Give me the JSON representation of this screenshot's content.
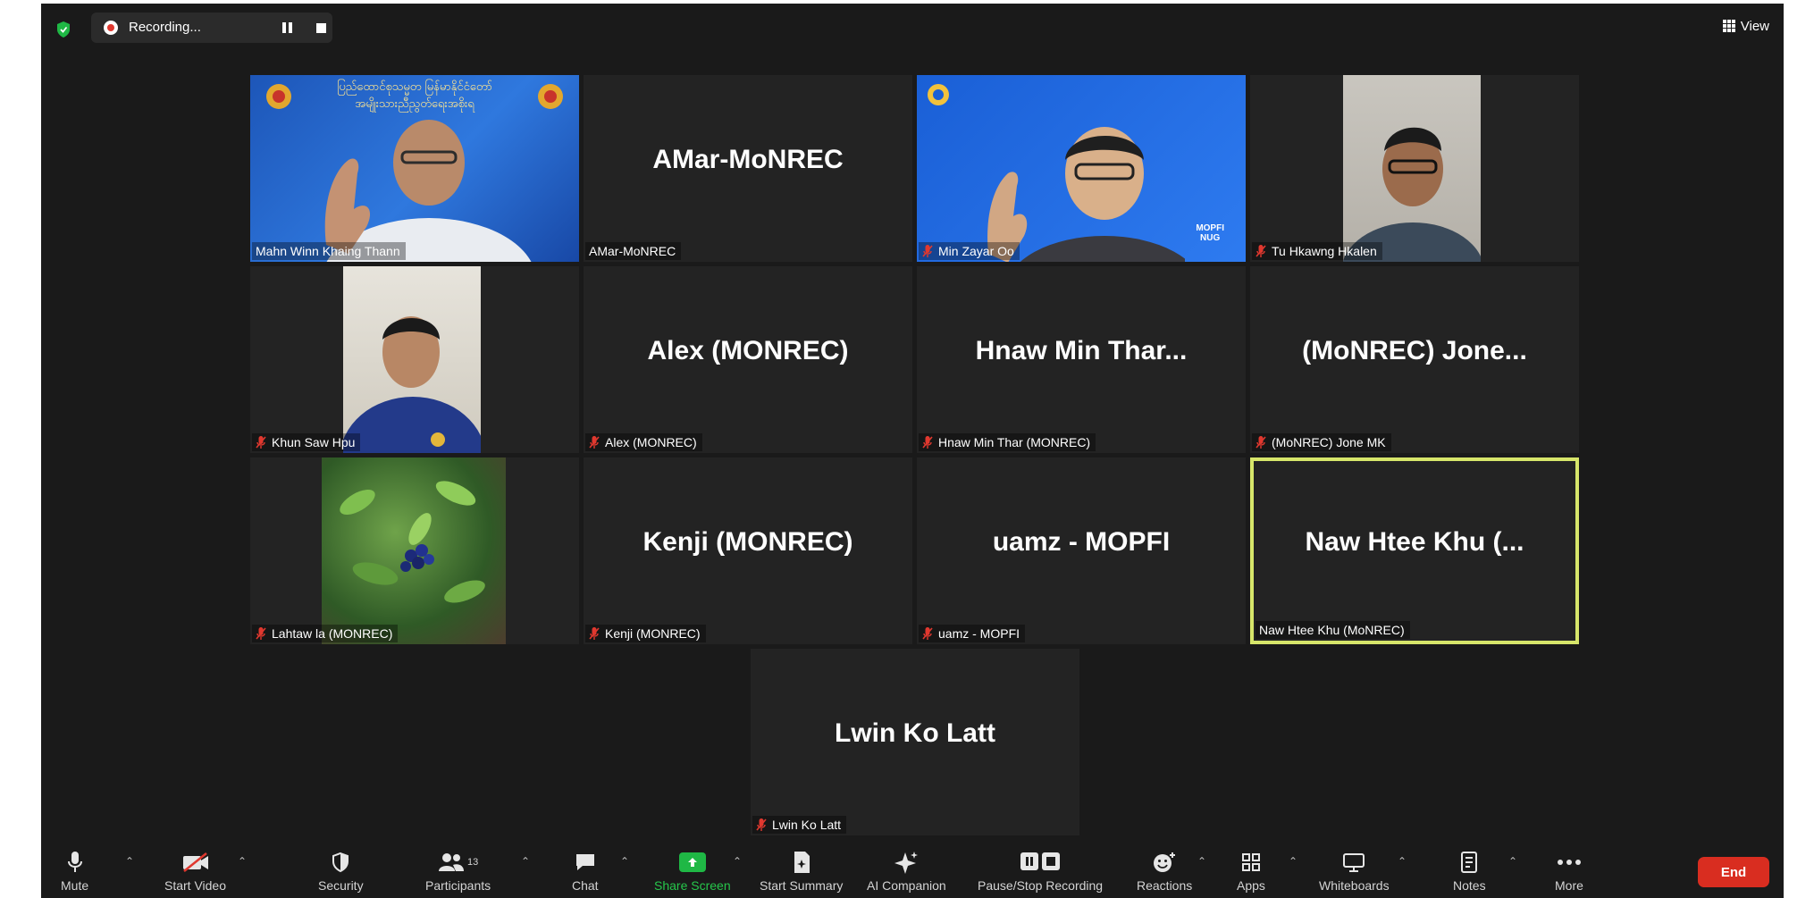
{
  "topbar": {
    "recording_label": "Recording...",
    "view_label": "View"
  },
  "tiles": [
    {
      "id": "mahn",
      "display_name": "",
      "nameplate": "Mahn Winn Khaing Thann",
      "muted": false
    },
    {
      "id": "amar",
      "display_name": "AMar-MoNREC",
      "nameplate": "AMar-MoNREC",
      "muted": false
    },
    {
      "id": "minzayar",
      "display_name": "",
      "nameplate": "Min Zayar Oo",
      "muted": true
    },
    {
      "id": "tuhkawng",
      "display_name": "",
      "nameplate": "Tu Hkawng Hkalen",
      "muted": true
    },
    {
      "id": "khunsaw",
      "display_name": "",
      "nameplate": "Khun Saw Hpu",
      "muted": true
    },
    {
      "id": "alex",
      "display_name": "Alex (MONREC)",
      "nameplate": "Alex (MONREC)",
      "muted": true
    },
    {
      "id": "hnaw",
      "display_name": "Hnaw Min Thar...",
      "nameplate": "Hnaw Min Thar (MONREC)",
      "muted": true
    },
    {
      "id": "jone",
      "display_name": "(MoNREC) Jone...",
      "nameplate": "(MoNREC) Jone MK",
      "muted": true
    },
    {
      "id": "lahtaw",
      "display_name": "",
      "nameplate": "Lahtaw la (MONREC)",
      "muted": true
    },
    {
      "id": "kenji",
      "display_name": "Kenji (MONREC)",
      "nameplate": "Kenji (MONREC)",
      "muted": true
    },
    {
      "id": "uamz",
      "display_name": "uamz - MOPFI",
      "nameplate": "uamz - MOPFI",
      "muted": true
    },
    {
      "id": "nawhtee",
      "display_name": "Naw Htee Khu (...",
      "nameplate": "Naw Htee Khu (MoNREC)",
      "muted": false
    },
    {
      "id": "lwinko",
      "display_name": "Lwin Ko Latt",
      "nameplate": "Lwin Ko Latt",
      "muted": true
    }
  ],
  "video_overlays": {
    "mahn_banner_line1": "ပြည်ထောင်စုသမ္မတ မြန်မာနိုင်ငံတော်",
    "mahn_banner_line2": "အမျိုးသားညီညွတ်ရေးအစိုးရ",
    "minzayar_logo_text": "MOPFI",
    "minzayar_logo_sub": "NUG"
  },
  "toolbar": {
    "mute": "Mute",
    "start_video": "Start Video",
    "security": "Security",
    "participants": "Participants",
    "participants_count": "13",
    "chat": "Chat",
    "share_screen": "Share Screen",
    "start_summary": "Start Summary",
    "ai_companion": "AI Companion",
    "pause_stop_recording": "Pause/Stop Recording",
    "reactions": "Reactions",
    "apps": "Apps",
    "whiteboards": "Whiteboards",
    "notes": "Notes",
    "more": "More",
    "end": "End"
  },
  "colors": {
    "background": "#1a1a1a",
    "tile": "#232323",
    "active_speaker_border": "#d7e66a",
    "end_button": "#d92d20",
    "share_green": "#1fb845",
    "muted_red": "#e0382f"
  }
}
